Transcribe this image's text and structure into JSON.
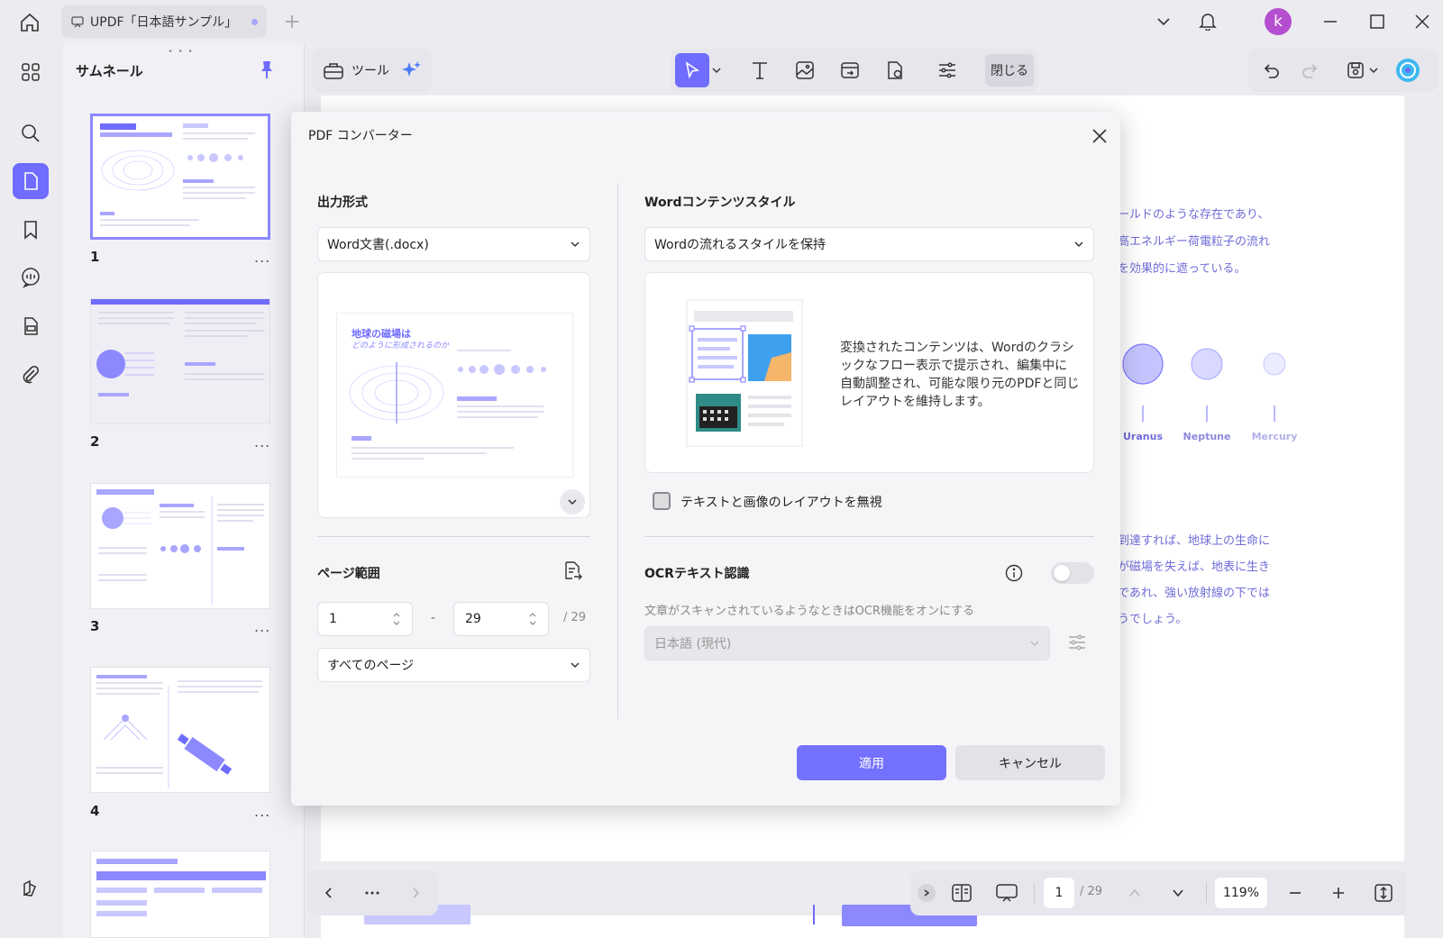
{
  "window": {
    "tab_title": "UPDF「日本語サンプル」",
    "avatar_letter": "k"
  },
  "sidebar": {
    "items": [
      {
        "icon": "grid-icon"
      },
      {
        "icon": "search-icon"
      },
      {
        "icon": "page-icon",
        "active": true
      },
      {
        "icon": "bookmark-icon"
      },
      {
        "icon": "comment-icon"
      },
      {
        "icon": "form-icon"
      },
      {
        "icon": "attachment-icon"
      },
      {
        "icon": "layers-icon"
      }
    ]
  },
  "thumbnails": {
    "title": "サムネール",
    "pages": [
      {
        "number": "1",
        "selected": true
      },
      {
        "number": "2"
      },
      {
        "number": "3"
      },
      {
        "number": "4"
      }
    ],
    "more": "..."
  },
  "toolbar": {
    "tools_label": "ツール",
    "close_label": "閉じる"
  },
  "document": {
    "lines_top": [
      "ールドのような存在であり、",
      "高エネルギー荷電粒子の流れ",
      "を効果的に遮っている。"
    ],
    "planets": [
      "Uranus",
      "Neptune",
      "Mercury"
    ],
    "lines_bottom": [
      "到達すれば、地球上の生命に",
      "が磁場を失えば、地表に生き",
      "であれ、強い放射線の下では",
      "うでしょう。"
    ]
  },
  "dialog": {
    "title": "PDF コンバーター",
    "output_format_label": "出力形式",
    "output_format_value": "Word文書(.docx)",
    "preview_title_1": "地球の磁場は",
    "preview_title_2": "どのように形成されるのか",
    "page_range_label": "ページ範囲",
    "range_from": "1",
    "range_dash": "-",
    "range_to": "29",
    "range_total": "/ 29",
    "range_option": "すべてのページ",
    "word_style_label": "Wordコンテンツスタイル",
    "word_style_value": "Wordの流れるスタイルを保持",
    "word_style_description": "変換されたコンテンツは、Wordのクラシックなフロー表示で提示され、編集中に自動調整され、可能な限り元のPDFと同じレイアウトを維持します。",
    "ignore_layout_label": "テキストと画像のレイアウトを無視",
    "ocr_label": "OCRテキスト認識",
    "ocr_hint": "文章がスキャンされているようなときはOCR機能をオンにする",
    "ocr_language": "日本語 (現代)",
    "apply_label": "適用",
    "cancel_label": "キャンセル"
  },
  "bottom": {
    "page_current": "1",
    "page_total": "/ 29",
    "zoom": "119%"
  },
  "colors": {
    "accent": "#7471ff",
    "doc_text": "#6f6cd8"
  }
}
